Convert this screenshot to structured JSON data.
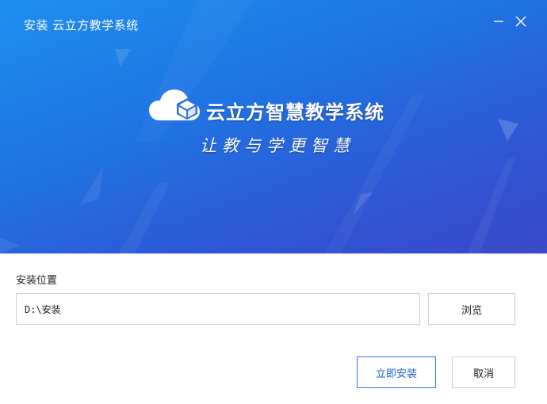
{
  "window": {
    "title": "安装 云立方教学系统",
    "minimize_icon": "minimize-icon",
    "close_icon": "close-icon"
  },
  "banner": {
    "logo_icon": "cloud-cube-logo-icon",
    "product_name": "云立方智慧教学系统",
    "slogan": "让教与学更智慧",
    "colors": {
      "gradient_start": "#1d8fee",
      "gradient_end": "#3a49c9"
    }
  },
  "form": {
    "location_label": "安装位置",
    "install_path": "D:\\安装",
    "browse_label": "浏览"
  },
  "actions": {
    "install_label": "立即安装",
    "cancel_label": "取消",
    "accent_color": "#2f72e0"
  }
}
